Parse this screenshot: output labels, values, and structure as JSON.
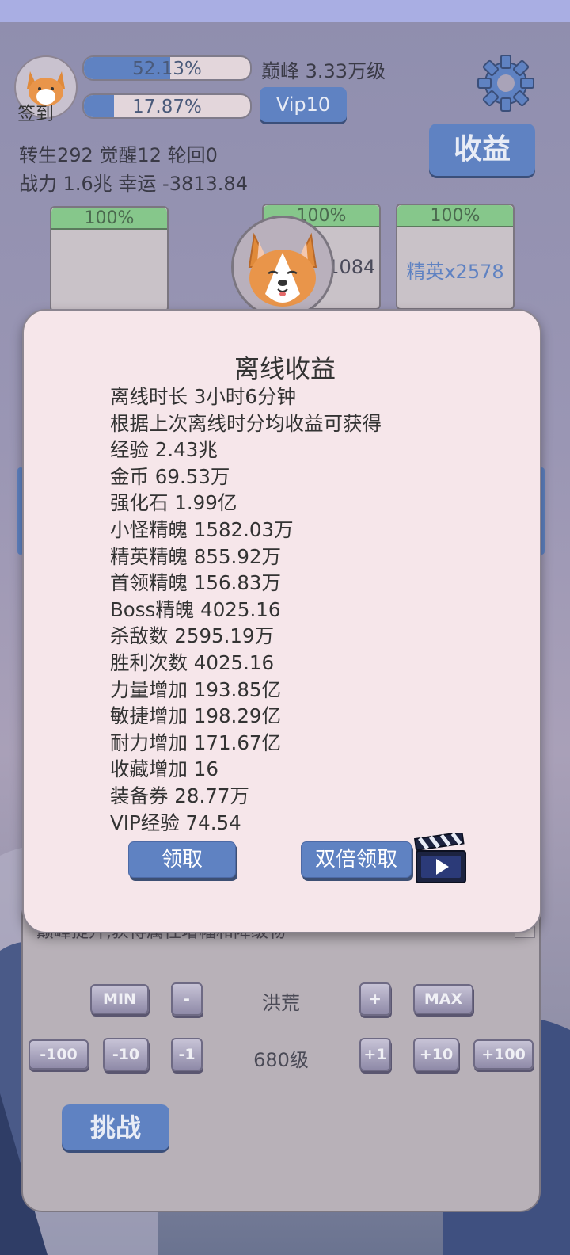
{
  "header": {
    "avatar_label": "签到",
    "progress1": {
      "text": "52.13%",
      "fill": 0.5213
    },
    "progress2": {
      "text": "17.87%",
      "fill": 0.1787
    },
    "peak_text": "巅峰 3.33万级",
    "vip_label": "Vip10",
    "earnings_button": "收益",
    "stats_line1": "转生292 觉醒12 轮回0",
    "stats_line2": "战力 1.6兆  幸运 -3813.84"
  },
  "slots": [
    {
      "percent": "100%",
      "label": ""
    },
    {
      "percent": "100%",
      "label": "x1084"
    },
    {
      "percent": "100%",
      "label": "精英x2578"
    }
  ],
  "background_panel": {
    "partial_text": "巅峰提升,获得属性增幅和降级物",
    "difficulty": "洪荒",
    "level": "680级",
    "row1_buttons": [
      "MIN",
      "-",
      "+",
      "MAX"
    ],
    "row2_buttons": [
      "-100",
      "-10",
      "-1",
      "+1",
      "+10",
      "+100"
    ],
    "challenge_button": "挑战"
  },
  "dialog": {
    "title": "离线收益",
    "lines": [
      "离线时长 3小时6分钟",
      "根据上次离线时分均收益可获得",
      "经验   2.43兆",
      "金币   69.53万",
      "强化石  1.99亿",
      "小怪精魄 1582.03万",
      "精英精魄 855.92万",
      "首领精魄 156.83万",
      "Boss精魄 4025.16",
      "杀敌数  2595.19万",
      "胜利次数 4025.16",
      "力量增加 193.85亿",
      "敏捷增加 198.29亿",
      "耐力增加 171.67亿",
      "收藏增加 16",
      "装备券  28.77万",
      "VIP经验 74.54"
    ],
    "claim_button": "领取",
    "double_claim_button": "双倍领取"
  },
  "colors": {
    "accent": "#5f82c2",
    "dialog_bg": "#f6e6ea",
    "bar_green": "#86c78b"
  },
  "icons": {
    "settings": "gear-icon",
    "video": "clapperboard-icon",
    "pet": "corgi-icon"
  }
}
